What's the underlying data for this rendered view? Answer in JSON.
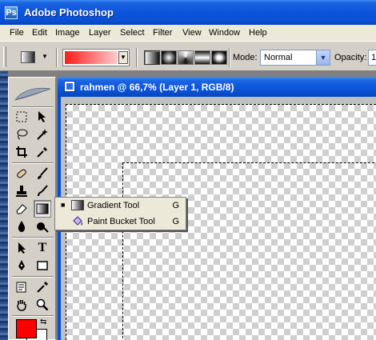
{
  "app": {
    "title": "Adobe Photoshop",
    "logo_text": "Ps"
  },
  "menu": [
    "File",
    "Edit",
    "Image",
    "Layer",
    "Select",
    "Filter",
    "View",
    "Window",
    "Help"
  ],
  "options": {
    "mode_label": "Mode:",
    "mode_value": "Normal",
    "opacity_label": "Opacity:",
    "opacity_value": "1",
    "gradient_colors": [
      "#ff1a1a",
      "#ffcccc"
    ]
  },
  "document": {
    "title": "rahmen @ 66,7% (Layer 1, RGB/8)"
  },
  "flyout": [
    {
      "label": "Gradient Tool",
      "shortcut": "G",
      "selected_mark": "■",
      "icon": "gradient-icon"
    },
    {
      "label": "Paint Bucket Tool",
      "shortcut": "G",
      "selected_mark": "",
      "icon": "paint-bucket-icon"
    }
  ],
  "colors": {
    "foreground": "#ff0000",
    "background": "#ffffff",
    "titlebar_blue": "#0a55dc"
  },
  "toolbox_icons": [
    "rect-marquee-icon",
    "move-icon",
    "lasso-icon",
    "magic-wand-icon",
    "crop-icon",
    "slice-icon",
    "healing-brush-icon",
    "brush-icon",
    "clone-stamp-icon",
    "history-brush-icon",
    "eraser-icon",
    "gradient-icon",
    "blur-icon",
    "dodge-icon",
    "path-select-icon",
    "type-icon",
    "pen-icon",
    "rectangle-shape-icon",
    "notes-icon",
    "eyedropper-icon",
    "hand-icon",
    "zoom-icon"
  ]
}
